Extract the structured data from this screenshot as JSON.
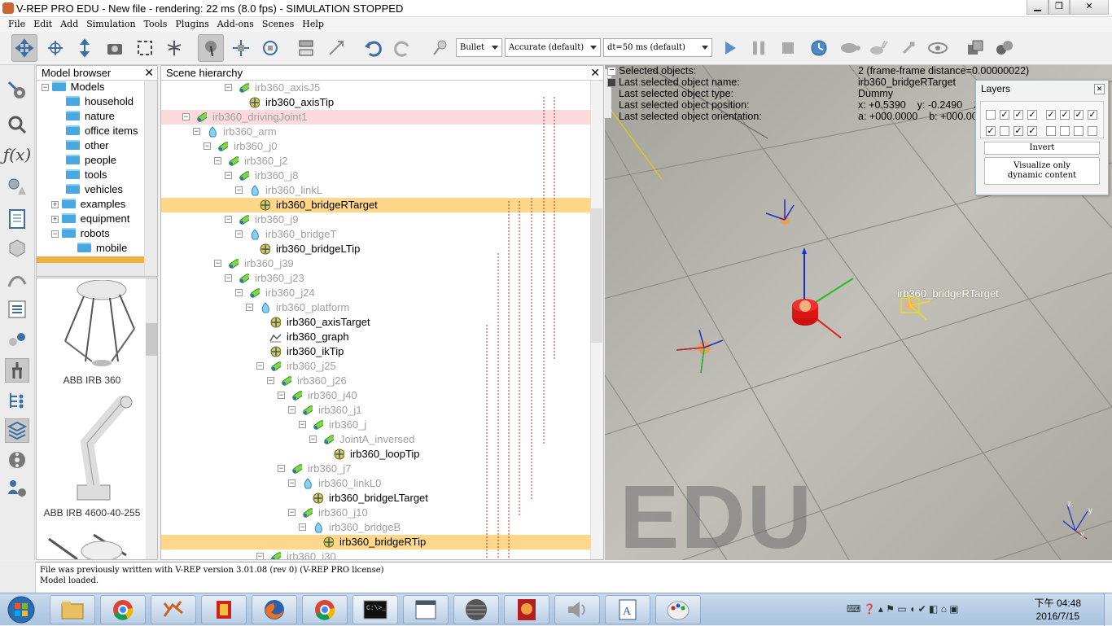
{
  "window": {
    "title": "V-REP PRO EDU - New file - rendering: 22 ms (8.0 fps) - SIMULATION STOPPED"
  },
  "menu": [
    "File",
    "Edit",
    "Add",
    "Simulation",
    "Tools",
    "Plugins",
    "Add-ons",
    "Scenes",
    "Help"
  ],
  "toolbar": {
    "engine": "Bullet",
    "accuracy": "Accurate (default)",
    "dt": "dt=50 ms (default)"
  },
  "model_browser": {
    "title": "Model browser",
    "root": "Models",
    "items": [
      "household",
      "nature",
      "office items",
      "other",
      "people",
      "tools",
      "vehicles",
      "examples",
      "equipment",
      "robots",
      "mobile"
    ],
    "thumbnails": [
      "ABB IRB 360",
      "ABB IRB 4600-40-255"
    ]
  },
  "scene_hierarchy": {
    "title": "Scene hierarchy",
    "rows": [
      "irb360_axisJ5",
      "irb360_axisTip",
      "irb360_drivingJoint1",
      "irb360_arm",
      "irb360_j0",
      "irb360_j2",
      "irb360_j8",
      "irb360_linkL",
      "irb360_bridgeRTarget",
      "irb360_j9",
      "irb360_bridgeT",
      "irb360_bridgeLTip",
      "irb360_j39",
      "irb360_j23",
      "irb360_j24",
      "irb360_platform",
      "irb360_axisTarget",
      "irb360_graph",
      "irb360_ikTip",
      "irb360_j25",
      "irb360_j26",
      "irb360_j40",
      "irb360_j1",
      "irb360_j",
      "JointA_inversed",
      "irb360_loopTip",
      "irb360_j7",
      "irb360_linkL0",
      "irb360_bridgeLTarget",
      "irb360_j10",
      "irb360_bridgeB",
      "irb360_bridgeRTip",
      "irb360_j30"
    ]
  },
  "info": {
    "labels": [
      "Selected objects:",
      "Last selected object name:",
      "Last selected object type:",
      "Last selected object position:",
      "Last selected object orientation:"
    ],
    "values": [
      "2 (frame-frame distance=0.00000022)",
      "irb360_bridgeRTarget",
      "Dummy",
      "x: +0.5390    y: -0.2490    z",
      "a: +000.0000    b: +000.00"
    ]
  },
  "viewport": {
    "object_label": "irb360_bridgeRTarget",
    "watermark": "EDU"
  },
  "layers": {
    "title": "Layers",
    "invert": "Invert",
    "visualize": "Visualize only dynamic content",
    "row1": [
      false,
      true,
      true,
      true,
      true,
      true,
      true,
      true
    ],
    "row2": [
      true,
      false,
      true,
      true,
      false,
      false,
      false,
      false
    ]
  },
  "status": {
    "line1": "File was previously written with V-REP version 3.01.08 (rev 0) (V-REP PRO license)",
    "line2": "Model loaded."
  },
  "taskbar": {
    "time": "下午 04:48",
    "date": "2016/7/15"
  },
  "colors": {
    "selection": "#ffd78a",
    "pinkrow": "#fadadd",
    "folder": "#4aa8e0"
  }
}
